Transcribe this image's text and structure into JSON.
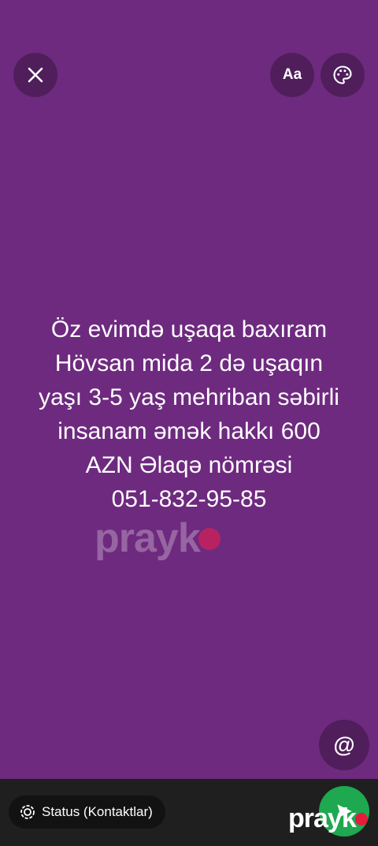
{
  "toolbar": {
    "close_icon": "close-icon",
    "font_label": "Aa",
    "palette_icon": "palette-icon"
  },
  "status": {
    "text_lines": [
      "Öz evimdə uşaqa baxıram",
      "Hövsan mida 2 də uşaqın",
      "yaşı 3-5 yaş mehriban səbirli",
      "insanam əmək hakkı 600",
      "AZN Əlaqə nömrəsi",
      "051-832-95-85"
    ],
    "background_color": "#6e2a7f"
  },
  "watermark": {
    "text": "prayk"
  },
  "mention": {
    "icon": "at-icon",
    "label": "@"
  },
  "bottom": {
    "audience_icon": "status-ring-icon",
    "audience_label": "Status (Kontaktlar)",
    "send_icon": "send-icon",
    "send_color": "#1ea84f",
    "footer_watermark": "prayk"
  }
}
